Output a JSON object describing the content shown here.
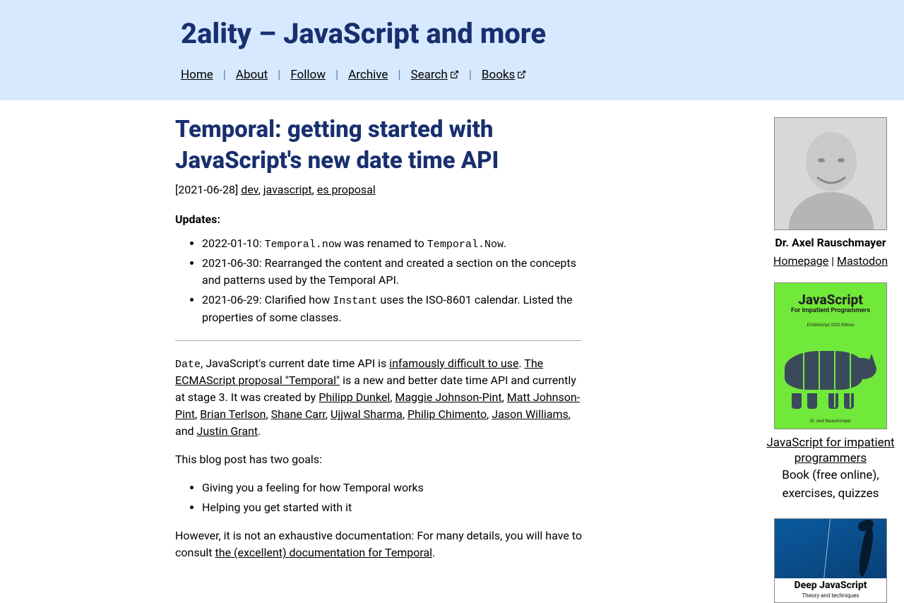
{
  "site": {
    "title": "2ality – JavaScript and more"
  },
  "nav": {
    "home": "Home",
    "about": "About",
    "follow": "Follow",
    "archive": "Archive",
    "search": "Search",
    "books": "Books",
    "sep": "|"
  },
  "article": {
    "title": "Temporal: getting started with JavaScript's new date time API",
    "date": "[2021-06-28] ",
    "tag1": "dev",
    "tag2": "javascript",
    "tag3": "es proposal",
    "comma": ", ",
    "updates_label": "Updates:",
    "u1a": "2022-01-10: ",
    "u1code1": "Temporal.now",
    "u1b": " was renamed to ",
    "u1code2": "Temporal.Now",
    "u1c": ".",
    "u2": "2021-06-30: Rearranged the content and created a section on the concepts and patterns used by the Temporal API.",
    "u3a": "2021-06-29: Clarified how ",
    "u3code": "Instant",
    "u3b": " uses the ISO-8601 calendar. Listed the properties of some classes.",
    "p1_code": "Date",
    "p1_a": ", JavaScript's current date time API is ",
    "p1_l1": "infamously difficult to use",
    "p1_b": ". ",
    "p1_l2": "The ECMAScript proposal \"Temporal\"",
    "p1_c": " is a new and better date time API and currently at stage 3. It was created by ",
    "p1_n1": "Philipp Dunkel",
    "p1_n2": "Maggie Johnson-Pint",
    "p1_n3": "Matt Johnson-Pint",
    "p1_n4": "Brian Terlson",
    "p1_n5": "Shane Carr",
    "p1_n6": "Ujjwal Sharma",
    "p1_n7": "Philip Chimento",
    "p1_n8": "Jason Williams",
    "p1_and": ", and ",
    "p1_n9": "Justin Grant",
    "p1_end": ".",
    "p2": "This blog post has two goals:",
    "g1": "Giving you a feeling for how Temporal works",
    "g2": "Helping you get started with it",
    "p3a": "However, it is not an exhaustive documentation: For many details, you will have to consult ",
    "p3_l": "the (excellent) documentation for Temporal",
    "p3b": "."
  },
  "sidebar": {
    "author": "Dr. Axel Rauschmayer",
    "homepage": "Homepage",
    "sep": " | ",
    "mastodon": "Mastodon",
    "book1_t1": "JavaScript",
    "book1_t2": "For Impatient Programmers",
    "book1_t3": "ECMAScript 2022 Edition",
    "book1_auth": "Dr. Axel Rauschmayer",
    "book1_link": "JavaScript for impatient programmers",
    "book1_sub": "Book (free online), exercises, quizzes",
    "book2_t1": "Deep JavaScript",
    "book2_t2": "Theory and techniques"
  }
}
